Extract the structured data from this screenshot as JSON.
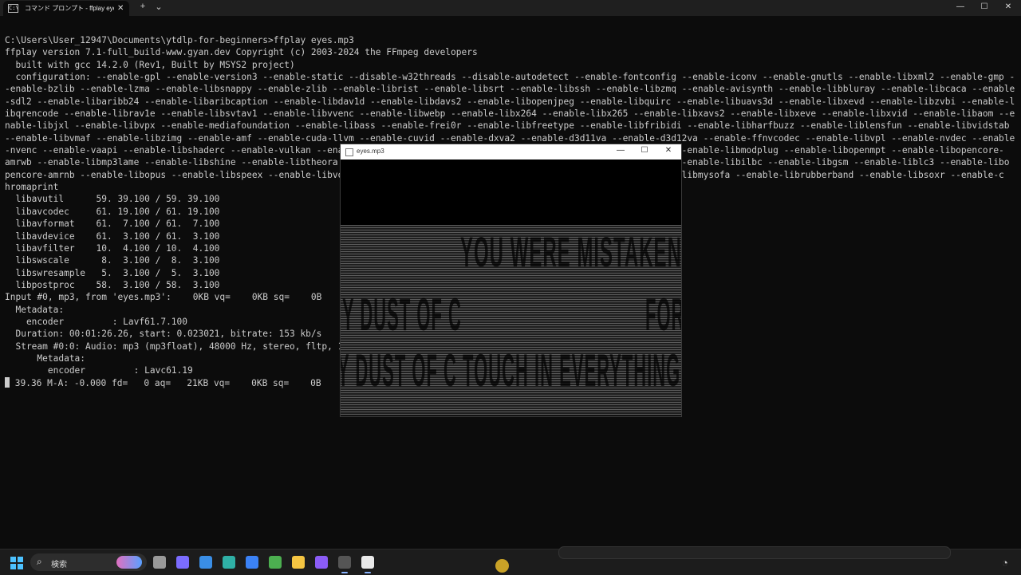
{
  "window": {
    "tab_title": "コマンド プロンプト - ffplay  eyes.mp3",
    "tab_icon": "terminal-icon",
    "new_tab_label": "+",
    "dropdown_label": "⌄",
    "tab_close_label": "✕",
    "minimize_label": "—",
    "maximize_label": "☐",
    "close_label": "✕"
  },
  "terminal": {
    "lines": [
      "C:\\Users\\User_12947\\Documents\\ytdlp-for-beginners>ffplay eyes.mp3",
      "ffplay version 7.1-full_build-www.gyan.dev Copyright (c) 2003-2024 the FFmpeg developers",
      "  built with gcc 14.2.0 (Rev1, Built by MSYS2 project)",
      "  configuration: --enable-gpl --enable-version3 --enable-static --disable-w32threads --disable-autodetect --enable-fontconfig --enable-iconv --enable-gnutls --enable-libxml2 --enable-gmp -",
      "-enable-bzlib --enable-lzma --enable-libsnappy --enable-zlib --enable-librist --enable-libsrt --enable-libssh --enable-libzmq --enable-avisynth --enable-libbluray --enable-libcaca --enable",
      "-sdl2 --enable-libaribb24 --enable-libaribcaption --enable-libdav1d --enable-libdavs2 --enable-libopenjpeg --enable-libquirc --enable-libuavs3d --enable-libxevd --enable-libzvbi --enable-l",
      "ibqrencode --enable-librav1e --enable-libsvtav1 --enable-libvvenc --enable-libwebp --enable-libx264 --enable-libx265 --enable-libxavs2 --enable-libxeve --enable-libxvid --enable-libaom --e",
      "nable-libjxl --enable-libvpx --enable-mediafoundation --enable-libass --enable-frei0r --enable-libfreetype --enable-libfribidi --enable-libharfbuzz --enable-liblensfun --enable-libvidstab",
      "--enable-libvmaf --enable-libzimg --enable-amf --enable-cuda-llvm --enable-cuvid --enable-dxva2 --enable-d3d11va --enable-d3d12va --enable-ffnvcodec --enable-libvpl --enable-nvdec --enable",
      "-nvenc --enable-vaapi --enable-libshaderc --enable-vulkan --ena                                                              --enable-libmodplug --enable-libopenmpt --enable-libopencore-",
      "amrwb --enable-libmp3lame --enable-libshine --enable-libtheora                                                               --enable-libilbc --enable-libgsm --enable-liblc3 --enable-libo",
      "pencore-amrnb --enable-libopus --enable-libspeex --enable-libvo                                                              -libmysofa --enable-librubberband --enable-libsoxr --enable-c",
      "hromaprint",
      "  libavutil      59. 39.100 / 59. 39.100",
      "  libavcodec     61. 19.100 / 61. 19.100",
      "  libavformat    61.  7.100 / 61.  7.100",
      "  libavdevice    61.  3.100 / 61.  3.100",
      "  libavfilter    10.  4.100 / 10.  4.100",
      "  libswscale      8.  3.100 /  8.  3.100",
      "  libswresample   5.  3.100 /  5.  3.100",
      "  libpostproc    58.  3.100 / 58.  3.100",
      "Input #0, mp3, from 'eyes.mp3':    0KB vq=    0KB sq=    0B",
      "  Metadata:",
      "    encoder         : Lavf61.7.100",
      "  Duration: 00:01:26.26, start: 0.023021, bitrate: 153 kb/s",
      "  Stream #0:0: Audio: mp3 (mp3float), 48000 Hz, stereo, fltp, 1",
      "      Metadata:",
      "        encoder         : Lavc61.19"
    ],
    "status_line": " 39.36 M-A: -0.000 fd=   0 aq=   21KB vq=    0KB sq=    0B"
  },
  "ffplay_window": {
    "title": "eyes.mp3",
    "icon": "app-icon",
    "minimize_label": "—",
    "maximize_label": "☐",
    "close_label": "✕",
    "visual_text": {
      "line1": "YOU WERE MISTAKEN,",
      "line2": "Y DUST OF C",
      "line3": "Y DUST OF C  TOUCH IN EVERYTHING, FOR",
      "right_fragment": "FOR"
    }
  },
  "taskbar": {
    "search_placeholder": "検索",
    "search_icon": "search-icon",
    "apps": [
      {
        "name": "task-view-icon",
        "color": "#9a9a9a"
      },
      {
        "name": "copilot-icon",
        "color": "#7b6cff"
      },
      {
        "name": "store-icon",
        "color": "#3a8ee6"
      },
      {
        "name": "edge-icon",
        "color": "#2fb0a6"
      },
      {
        "name": "mail-icon",
        "color": "#3b82f6"
      },
      {
        "name": "minecraft-icon",
        "color": "#4caf50"
      },
      {
        "name": "file-explorer-icon",
        "color": "#f5c542"
      },
      {
        "name": "media-player-icon",
        "color": "#8b5cf6"
      },
      {
        "name": "terminal-icon",
        "color": "#555555"
      },
      {
        "name": "ffplay-icon",
        "color": "#e9e9e9"
      }
    ]
  }
}
